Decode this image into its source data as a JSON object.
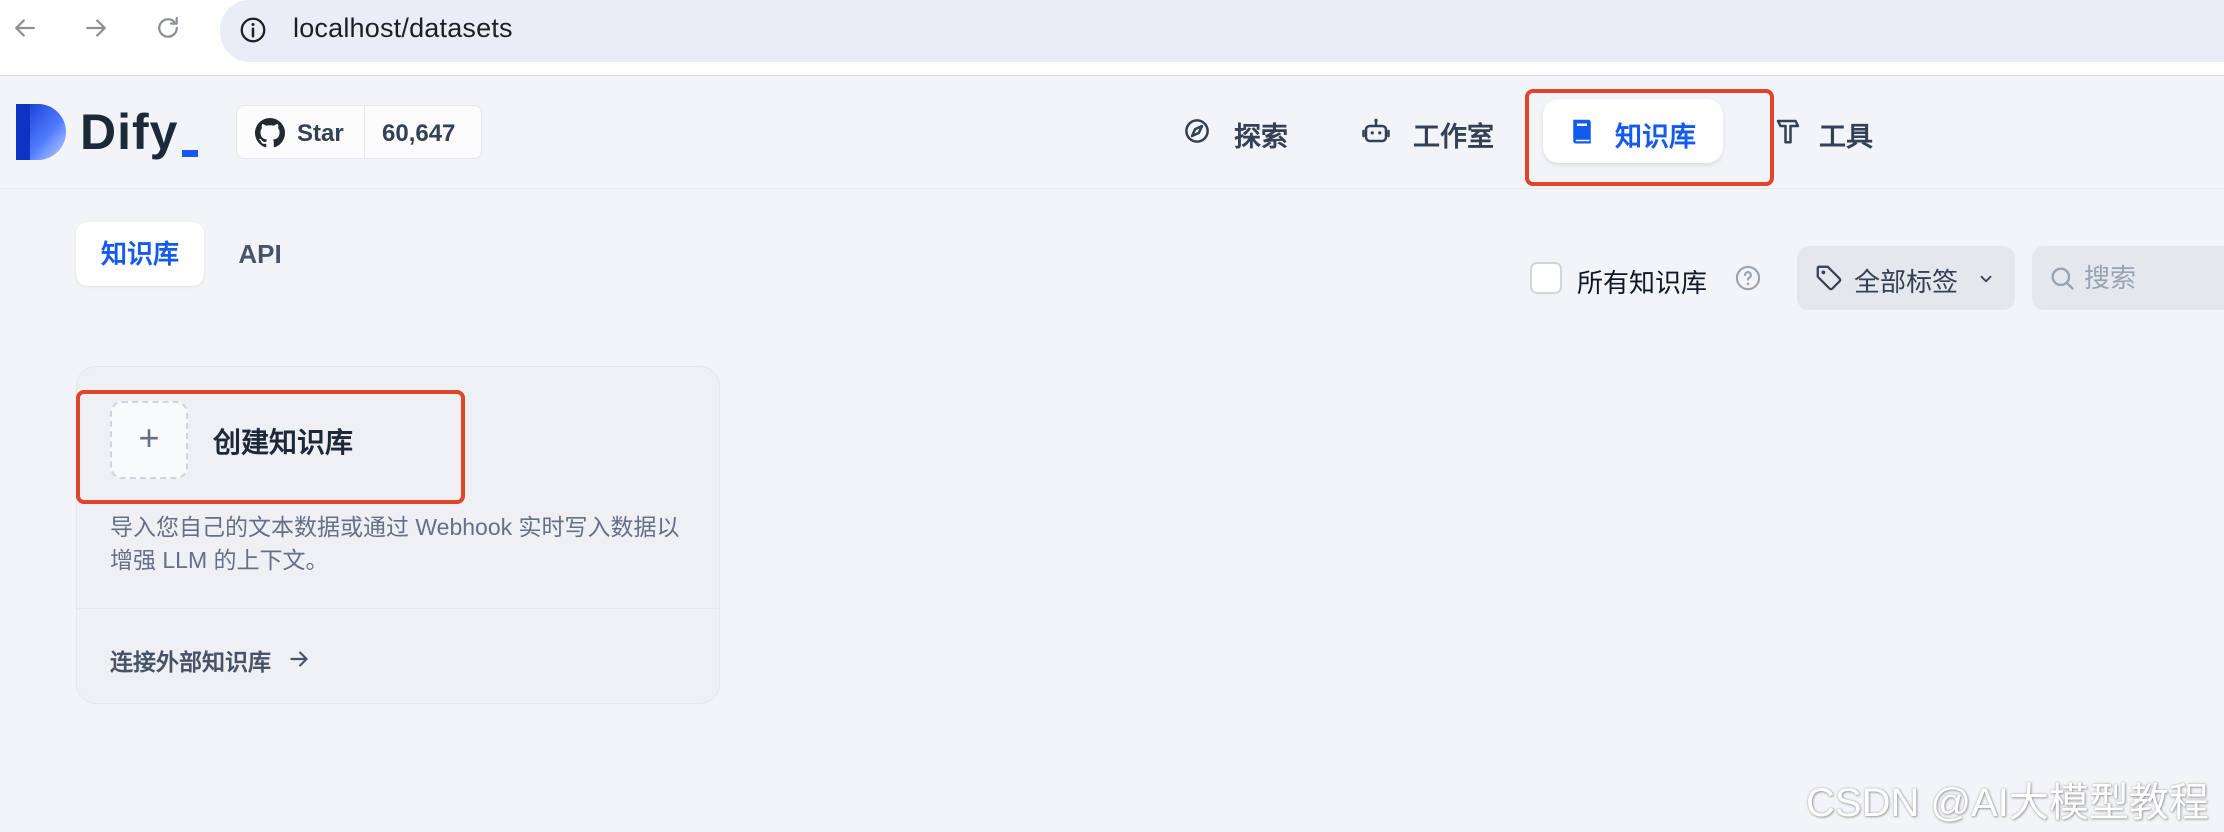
{
  "browser": {
    "url": "localhost/datasets"
  },
  "header": {
    "logo_text": "Dify",
    "github": {
      "label": "Star",
      "count": "60,647"
    },
    "nav": [
      {
        "label": "探索",
        "icon": "compass-icon"
      },
      {
        "label": "工作室",
        "icon": "robot-icon"
      },
      {
        "label": "知识库",
        "icon": "book-icon",
        "active": true
      },
      {
        "label": "工具",
        "icon": "hammer-icon"
      }
    ]
  },
  "tabs": [
    {
      "label": "知识库",
      "active": true
    },
    {
      "label": "API",
      "active": false
    }
  ],
  "filters": {
    "all_knowledge_label": "所有知识库",
    "all_knowledge_checked": false,
    "tag_filter_label": "全部标签",
    "search_placeholder": "搜索"
  },
  "create_card": {
    "title": "创建知识库",
    "plus_symbol": "+",
    "description": "导入您自己的文本数据或通过 Webhook 实时写入数据以增强 LLM 的上下文。",
    "connect_label": "连接外部知识库"
  },
  "watermark": "CSDN @AI大模型教程",
  "colors": {
    "accent": "#155aef",
    "highlight_box": "#e0452b",
    "background": "#f2f4f7"
  }
}
